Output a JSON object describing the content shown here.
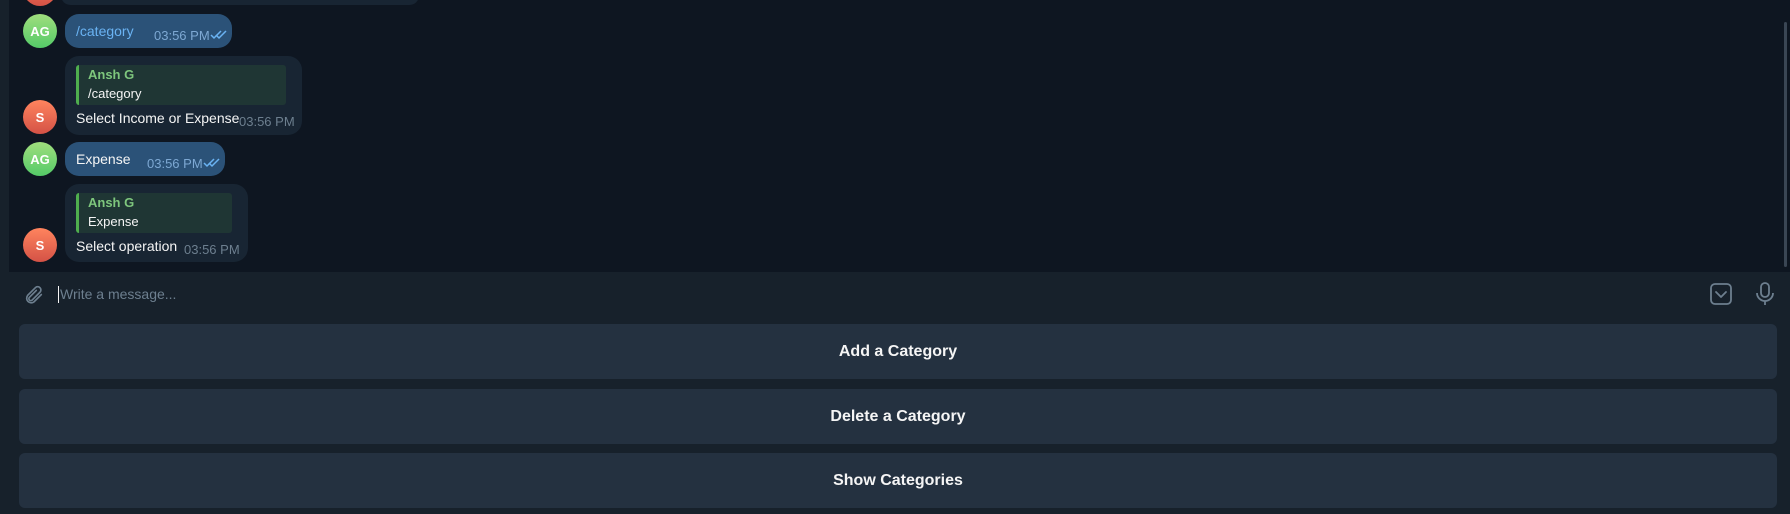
{
  "colors": {
    "chat_background": "#0e1621",
    "outgoing_bubble": "#2b5278",
    "incoming_bubble": "#182533",
    "reply_accent": "#4fae4e",
    "panel": "#17212b",
    "keyboard_button": "#243140"
  },
  "messages": [
    {
      "avatar": "AG",
      "text": "/category",
      "time": "03:56 PM"
    },
    {
      "avatar": "S",
      "reply_name": "Ansh G",
      "reply_text": "/category",
      "text": "Select Income or Expense",
      "time": "03:56 PM"
    },
    {
      "avatar": "AG",
      "text": "Expense",
      "time": "03:56 PM"
    },
    {
      "avatar": "S",
      "reply_name": "Ansh G",
      "reply_text": "Expense",
      "text": "Select operation",
      "time": "03:56 PM"
    }
  ],
  "composer": {
    "placeholder": "Write a message...",
    "attach_icon": "paperclip-icon",
    "keyboard_icon": "keyboard-toggle-icon",
    "mic_icon": "microphone-icon"
  },
  "keyboard": {
    "buttons": [
      {
        "label": "Add a Category"
      },
      {
        "label": "Delete a Category"
      },
      {
        "label": "Show Categories"
      }
    ]
  }
}
